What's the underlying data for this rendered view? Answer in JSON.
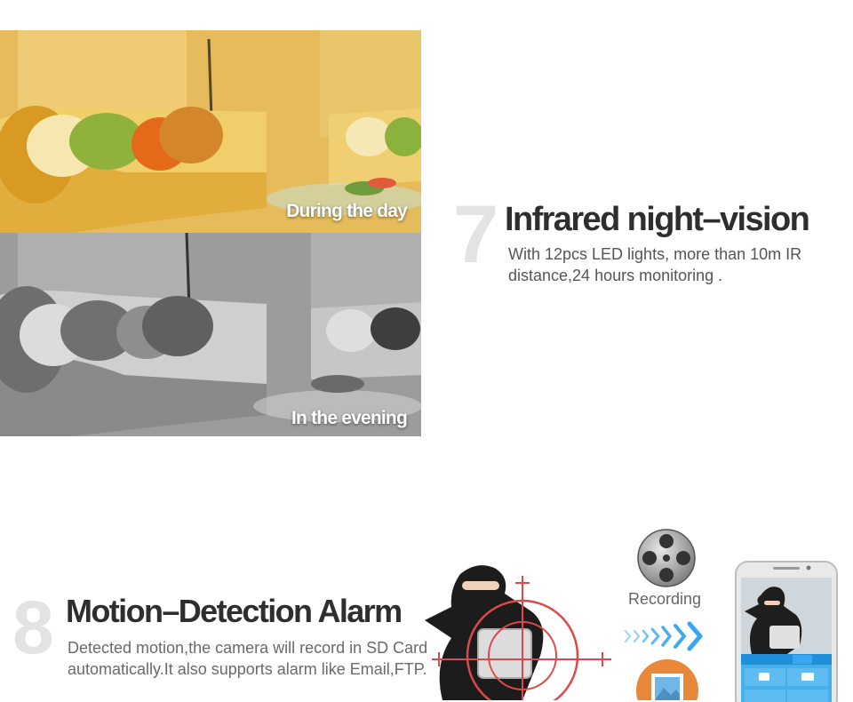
{
  "feature7": {
    "number": "7",
    "title": "Infrared night–vision",
    "description": "With 12pcs LED lights, more than 10m IR distance,24 hours monitoring .",
    "day_caption": "During the day",
    "night_caption": "In the evening"
  },
  "feature8": {
    "number": "8",
    "title": "Motion–Detection Alarm",
    "description": "Detected motion,the camera will record in SD Card automatically.It also supports alarm like Email,FTP.",
    "recording_label": "Recording"
  },
  "colors": {
    "title": "#2e2e2e",
    "number": "#e3e3e3",
    "arrow": "#3aa5f0",
    "crosshair": "#e04848"
  }
}
